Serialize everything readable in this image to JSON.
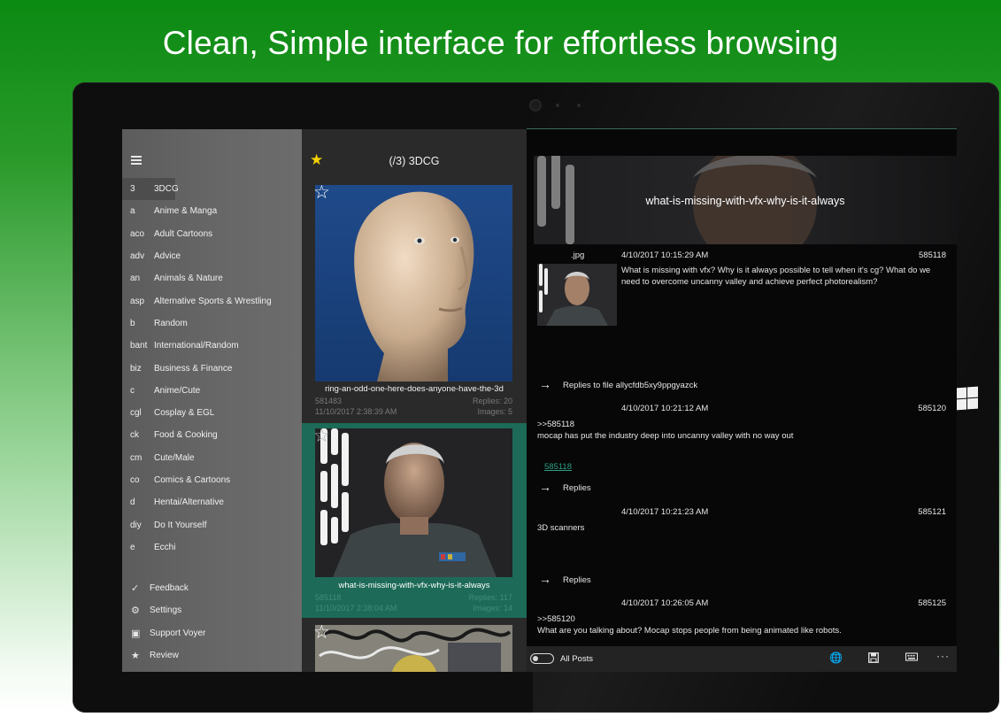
{
  "headline": "Clean, Simple interface for effortless browsing",
  "sidebar": {
    "menu_icon": "hamburger-icon",
    "boards": [
      {
        "code": "3",
        "name": "3DCG",
        "active": true
      },
      {
        "code": "a",
        "name": "Anime & Manga"
      },
      {
        "code": "aco",
        "name": "Adult Cartoons"
      },
      {
        "code": "adv",
        "name": "Advice"
      },
      {
        "code": "an",
        "name": "Animals & Nature"
      },
      {
        "code": "asp",
        "name": "Alternative Sports & Wrestling"
      },
      {
        "code": "b",
        "name": "Random"
      },
      {
        "code": "bant",
        "name": "International/Random"
      },
      {
        "code": "biz",
        "name": "Business & Finance"
      },
      {
        "code": "c",
        "name": "Anime/Cute"
      },
      {
        "code": "cgl",
        "name": "Cosplay & EGL"
      },
      {
        "code": "ck",
        "name": "Food & Cooking"
      },
      {
        "code": "cm",
        "name": "Cute/Male"
      },
      {
        "code": "co",
        "name": "Comics & Cartoons"
      },
      {
        "code": "d",
        "name": "Hentai/Alternative"
      },
      {
        "code": "diy",
        "name": "Do It Yourself"
      },
      {
        "code": "e",
        "name": "Ecchi"
      }
    ],
    "bottom_menu": [
      {
        "icon": "checkmark-icon",
        "glyph": "✓",
        "label": "Feedback"
      },
      {
        "icon": "gear-icon",
        "glyph": "⚙",
        "label": "Settings"
      },
      {
        "icon": "bag-icon",
        "glyph": "▣",
        "label": "Support Voyer"
      },
      {
        "icon": "star-icon",
        "glyph": "★",
        "label": "Review"
      }
    ]
  },
  "threads": {
    "header_title": "(/3)  3DCG",
    "header_star_color": "#f5d000",
    "cards": [
      {
        "title": "ring-an-odd-one-here-does-anyone-have-the-3d",
        "post_no": "581483",
        "date": "11/10/2017 2:38:39 AM",
        "replies": "Replies: 20",
        "images": "Images: 5"
      },
      {
        "title": "what-is-missing-with-vfx-why-is-it-always",
        "post_no": "585118",
        "date": "11/10/2017 2:38:04 AM",
        "replies": "Replies: 117",
        "images": "Images: 14",
        "selected": true
      }
    ]
  },
  "posts": {
    "hero_title": "what-is-missing-with-vfx-why-is-it-always",
    "op": {
      "file_ext": ".jpg",
      "date": "4/10/2017 10:15:29 AM",
      "number": "585118",
      "text": "What is missing with vfx? Why is it always possible to tell when it's cg? What do we need to overcome uncanny valley and achieve perfect photorealism?",
      "replies_label": "Replies to file allycfdb5xy9ppgyazck"
    },
    "replies": [
      {
        "date": "4/10/2017 10:21:12 AM",
        "number": "585120",
        "quote": ">>585118",
        "text": "mocap has put the industry deep into uncanny valley with no way out",
        "backlink": "585118",
        "replies_label": "Replies"
      },
      {
        "date": "4/10/2017 10:21:23 AM",
        "number": "585121",
        "text": "3D scanners",
        "replies_label": "Replies"
      },
      {
        "date": "4/10/2017 10:26:05 AM",
        "number": "585125",
        "quote": ">>585120",
        "text": "What are you talking about? Mocap stops people from being animated like robots."
      }
    ],
    "accent_color": "#2b9f85"
  },
  "command_bar": {
    "toggle_label": "All Posts",
    "icons": [
      {
        "name": "globe-icon",
        "glyph": "🌐"
      },
      {
        "name": "save-icon",
        "glyph": "💾"
      },
      {
        "name": "keyboard-icon",
        "glyph": "⌨"
      },
      {
        "name": "more-icon",
        "glyph": "···"
      }
    ]
  }
}
